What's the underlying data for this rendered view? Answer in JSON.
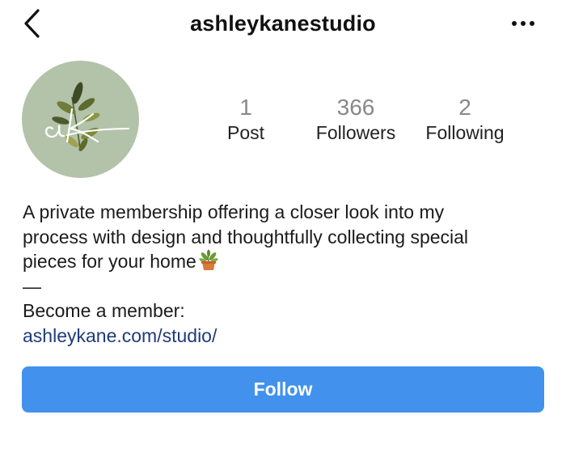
{
  "header": {
    "username": "ashleykanestudio",
    "back_icon": "chevron-left-icon",
    "more_icon": "more-horizontal-icon"
  },
  "profile": {
    "avatar_monogram": "ak",
    "avatar_color": "#b3c3a9"
  },
  "stats": [
    {
      "value": "1",
      "label": "Post"
    },
    {
      "value": "366",
      "label": "Followers"
    },
    {
      "value": "2",
      "label": "Following"
    }
  ],
  "bio": {
    "line1": "A private membership offering a closer look into my",
    "line2": "process with design and thoughtfully collecting special",
    "line3": "pieces for your home",
    "line3_icon": "potted-plant-icon",
    "divider": "—",
    "cta": "Become a member:",
    "link": "ashleykane.com/studio/",
    "link_color": "#1f3b78"
  },
  "actions": {
    "follow_label": "Follow",
    "follow_color": "#4191ed"
  }
}
